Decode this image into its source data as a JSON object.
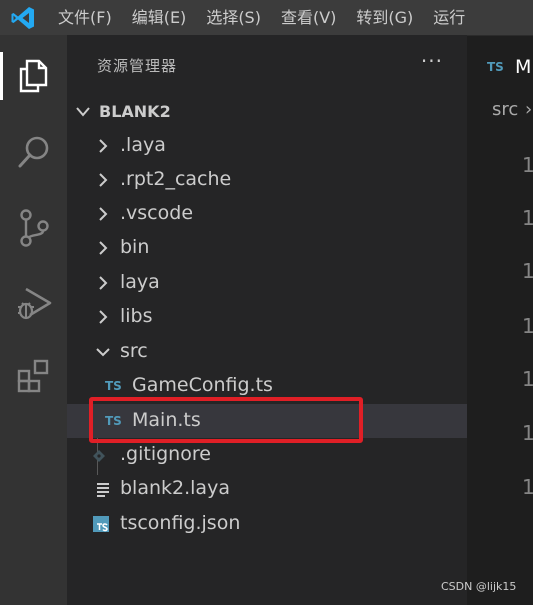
{
  "menubar": {
    "items": [
      "文件(F)",
      "编辑(E)",
      "选择(S)",
      "查看(V)",
      "转到(G)",
      "运行"
    ]
  },
  "activity_bar": {
    "items": [
      "explorer-icon",
      "search-icon",
      "source-control-icon",
      "run-debug-icon",
      "extensions-icon"
    ],
    "active": "explorer-icon"
  },
  "explorer": {
    "title": "资源管理器",
    "more": "···",
    "root": "BLANK2",
    "tree": [
      {
        "label": ".laya",
        "kind": "folder",
        "expanded": false
      },
      {
        "label": ".rpt2_cache",
        "kind": "folder",
        "expanded": false
      },
      {
        "label": ".vscode",
        "kind": "folder",
        "expanded": false
      },
      {
        "label": "bin",
        "kind": "folder",
        "expanded": false
      },
      {
        "label": "laya",
        "kind": "folder",
        "expanded": false
      },
      {
        "label": "libs",
        "kind": "folder",
        "expanded": false
      },
      {
        "label": "src",
        "kind": "folder",
        "expanded": true
      },
      {
        "label": "GameConfig.ts",
        "kind": "ts-file",
        "badge": "TS"
      },
      {
        "label": "Main.ts",
        "kind": "ts-file",
        "badge": "TS",
        "selected": true
      },
      {
        "label": ".gitignore",
        "kind": "git-file"
      },
      {
        "label": "blank2.laya",
        "kind": "laya-file"
      },
      {
        "label": "tsconfig.json",
        "kind": "tsconfig-file",
        "badge": "TS"
      }
    ]
  },
  "editor": {
    "tab": {
      "badge": "TS",
      "label": "M"
    },
    "breadcrumb": {
      "label": "src",
      "separator": "›"
    },
    "gutter": [
      "1",
      "1",
      "1",
      "1",
      "1",
      "1",
      "1",
      "1",
      "1",
      "1"
    ]
  },
  "colors": {
    "menubar_bg": "#3c3c3c",
    "activity_bg": "#333333",
    "sidebar_bg": "#252526",
    "editor_bg": "#1e1e1e",
    "selected_row": "#37373d",
    "highlight_box": "#e01f26",
    "ts_badge": "#519aba",
    "vscode_logo": "#23a9f2"
  },
  "watermark": "CSDN @lijk15"
}
